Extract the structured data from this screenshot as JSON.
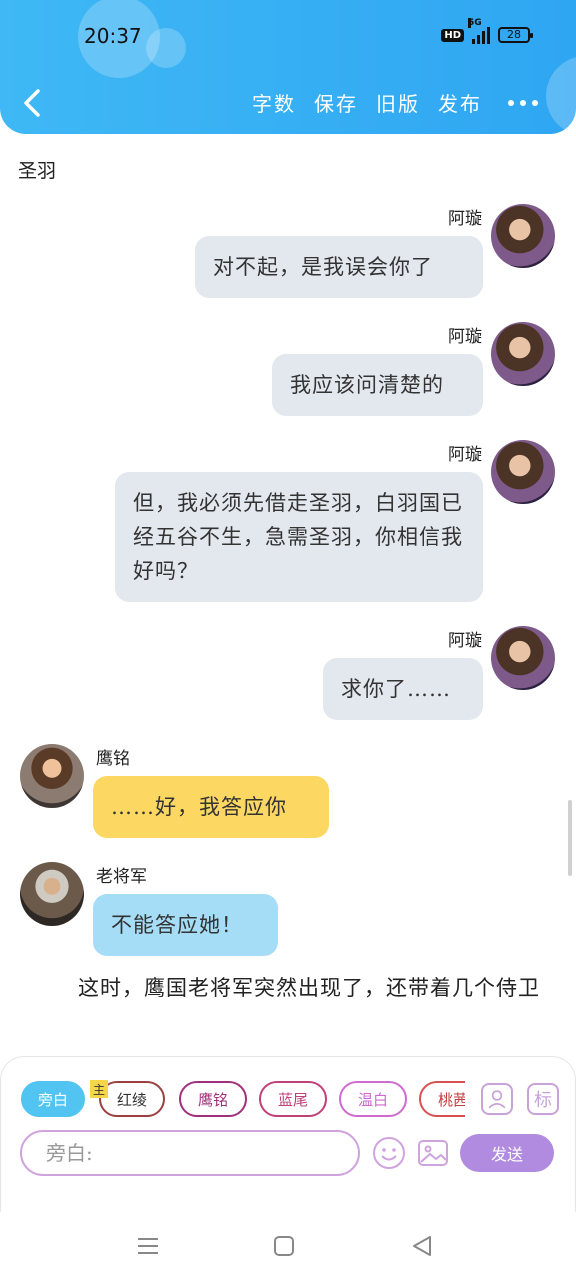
{
  "status_bar": {
    "time": "20:37",
    "hd": "HD",
    "network": "5G",
    "battery": "28"
  },
  "header": {
    "back_icon": "chevron-left-icon",
    "actions": [
      "字数",
      "保存",
      "旧版",
      "发布"
    ],
    "more_icon": "more-dots-icon",
    "colors": {
      "accent": "#2fa6f2"
    }
  },
  "chat": {
    "section_label": "圣羽",
    "messages": [
      {
        "speaker": "阿璇",
        "text": "对不起，是我误会你了"
      },
      {
        "speaker": "阿璇",
        "text": "我应该问清楚的"
      },
      {
        "speaker": "阿璇",
        "text": "但，我必须先借走圣羽，白羽国已经五谷不生，急需圣羽，你相信我好吗？"
      },
      {
        "speaker": "阿璇",
        "text": "求你了……"
      },
      {
        "speaker": "鹰铭",
        "text": "……好，我答应你"
      },
      {
        "speaker": "老将军",
        "text": "不能答应她！"
      }
    ],
    "narration": "这时，鹰国老将军突然出现了，还带着几个侍卫"
  },
  "composer": {
    "main_tag": "主",
    "chips": [
      "旁白",
      "红绫",
      "鹰铭",
      "蓝尾",
      "温白",
      "桃茜"
    ],
    "tag_button_label": "标",
    "input_placeholder": "旁白:",
    "send_label": "发送"
  },
  "system_nav": {
    "menu_icon": "menu-icon",
    "home_icon": "home-square-icon",
    "back_icon": "back-triangle-icon"
  }
}
